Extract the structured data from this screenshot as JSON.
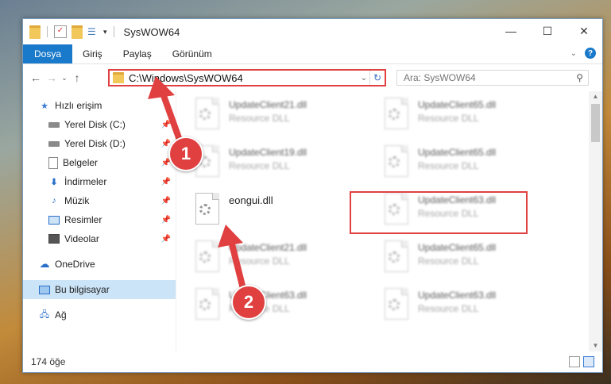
{
  "window": {
    "title": "SysWOW64",
    "controls": {
      "minimize": "—",
      "maximize": "☐",
      "close": "✕"
    }
  },
  "ribbon": {
    "tabs": [
      "Dosya",
      "Giriş",
      "Paylaş",
      "Görünüm"
    ]
  },
  "address": {
    "path": "C:\\Windows\\SysWOW64",
    "search_placeholder": "Ara: SysWOW64"
  },
  "nav": {
    "quick_access": "Hızlı erişim",
    "pinned": [
      {
        "label": "Yerel Disk (C:)",
        "icon": "drive-icon"
      },
      {
        "label": "Yerel Disk (D:)",
        "icon": "drive-icon"
      },
      {
        "label": "Belgeler",
        "icon": "documents-icon"
      },
      {
        "label": "İndirmeler",
        "icon": "download-icon"
      },
      {
        "label": "Müzik",
        "icon": "music-icon"
      },
      {
        "label": "Resimler",
        "icon": "pictures-icon"
      },
      {
        "label": "Videolar",
        "icon": "videos-icon"
      }
    ],
    "onedrive": "OneDrive",
    "this_pc": "Bu bilgisayar",
    "network": "Ağ"
  },
  "files": [
    {
      "name": "UpdateClient21.dll",
      "type": "Resource DLL"
    },
    {
      "name": "UpdateClient65.dll",
      "type": "Resource DLL"
    },
    {
      "name": "UpdateClient19.dll",
      "type": "Resource DLL"
    },
    {
      "name": "UpdateClient65.dll",
      "type": "Resource DLL"
    },
    {
      "name": "eongui.dll",
      "type": ""
    },
    {
      "name": "UpdateClient63.dll",
      "type": "Resource DLL"
    },
    {
      "name": "UpdateClient21.dll",
      "type": "Resource DLL"
    },
    {
      "name": "UpdateClient65.dll",
      "type": "Resource DLL"
    },
    {
      "name": "UpdateClient63.dll",
      "type": "Resource DLL"
    },
    {
      "name": "UpdateClient63.dll",
      "type": "Resource DLL"
    }
  ],
  "status": {
    "item_count": "174 öğe"
  },
  "annotations": {
    "step1": "1",
    "step2": "2"
  },
  "colors": {
    "accent": "#1979ca",
    "highlight": "#e04040"
  }
}
